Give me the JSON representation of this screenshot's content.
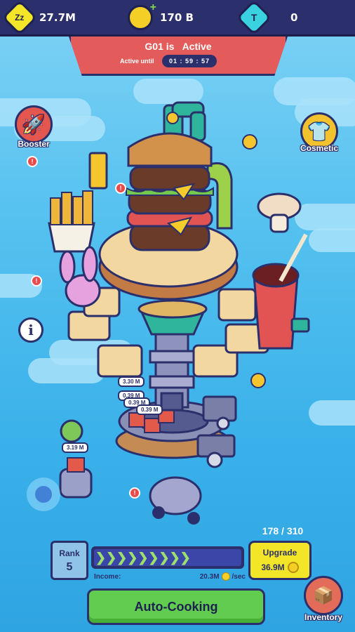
{
  "resources": {
    "zzz": {
      "icon": "zzz-icon",
      "label": "Zz",
      "value": "27.7M",
      "color": "#f3e628"
    },
    "coins": {
      "icon": "coin-icon",
      "value": "170 B",
      "color": "#f4d027"
    },
    "tokens": {
      "icon": "token-icon",
      "label": "T",
      "value": "0",
      "color": "#3ad1e0"
    }
  },
  "banner": {
    "title": "G01 is   Active",
    "until_label": "Active until",
    "timer": "01 : 59 : 57"
  },
  "side": {
    "booster_label": "Booster",
    "cosmetic_label": "Cosmetic",
    "info_label": "i"
  },
  "tags": [
    "3.30 M",
    "0.39 M",
    "0.39 M",
    "0.39 M",
    "3.19 M"
  ],
  "bottom": {
    "rank_label": "Rank",
    "rank_value": "5",
    "level_count": "178 / 310",
    "income_label": "Income:",
    "income_value": "20.3M",
    "income_unit": "/sec",
    "upgrade_label": "Upgrade",
    "upgrade_price": "36.9M",
    "auto_cooking_label": "Auto-Cooking",
    "inventory_label": "Inventory"
  },
  "colors": {
    "navy": "#2b2f6b",
    "banner": "#e45b5b",
    "green": "#61cc4f",
    "yellow": "#f3e628"
  }
}
